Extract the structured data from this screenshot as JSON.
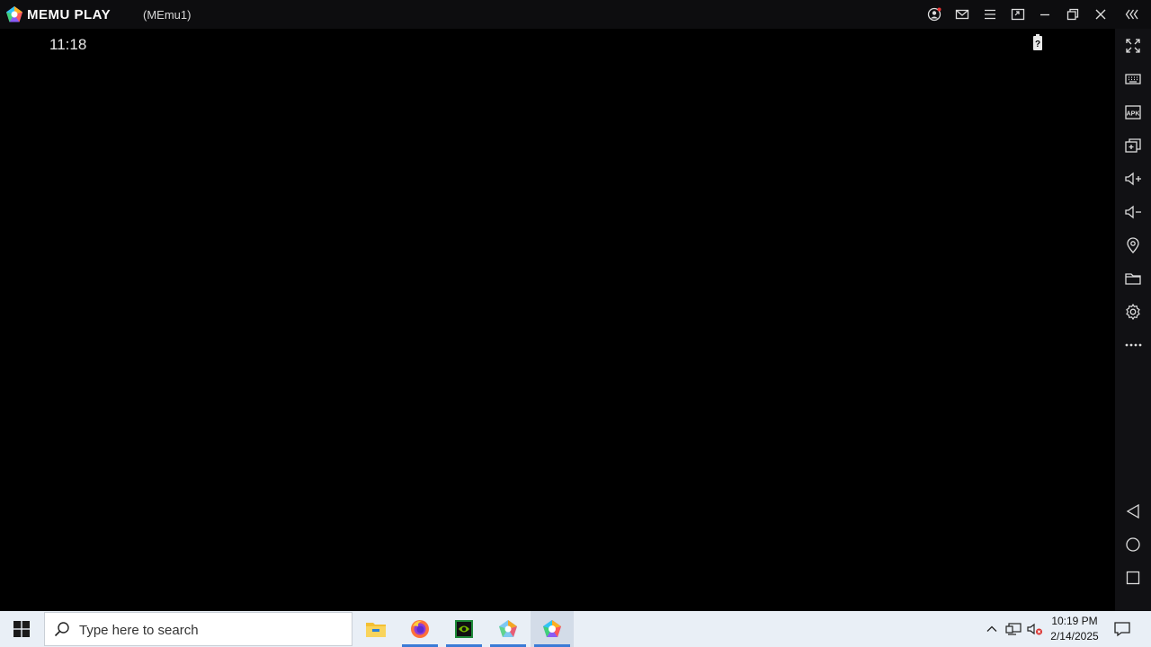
{
  "titlebar": {
    "brand": "MEMU PLAY",
    "instance": "(MEmu1)"
  },
  "android": {
    "clock": "11:18",
    "battery_icon": "battery-unknown-icon"
  },
  "sidebar": {
    "items": [
      "fullscreen",
      "keyboard-mapping",
      "install-apk",
      "multi-instance",
      "volume-up",
      "volume-down",
      "location",
      "shared-folder",
      "settings",
      "more",
      "back",
      "home",
      "recents"
    ]
  },
  "taskbar": {
    "search_placeholder": "Type here to search",
    "apps": [
      "file-explorer",
      "firefox",
      "nvidia",
      "memu-multi",
      "memu-play"
    ],
    "time": "10:19 PM",
    "date": "2/14/2025"
  },
  "colors": {
    "titlebar_bg": "#0d0d0f",
    "sidebar_bg": "#111114",
    "taskbar_bg": "#e9eff6",
    "accent": "#3b7bd6"
  }
}
